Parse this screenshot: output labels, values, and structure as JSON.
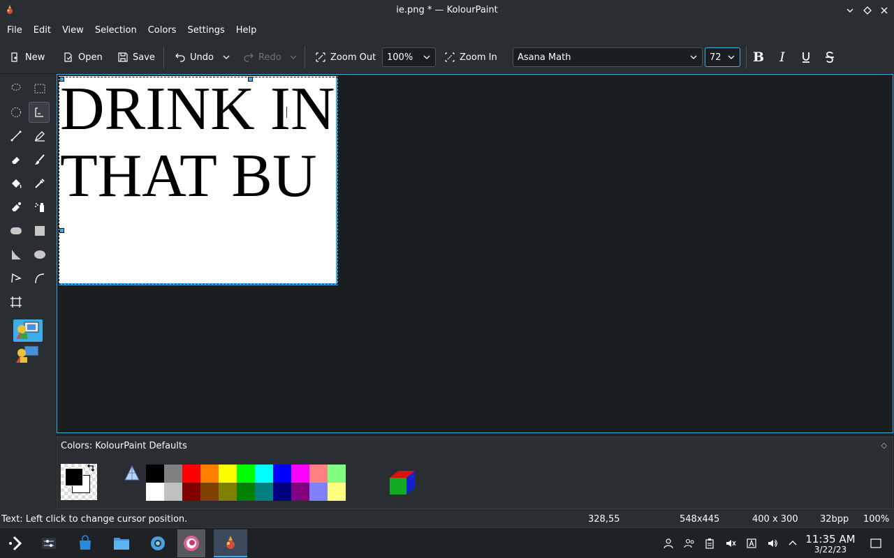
{
  "window": {
    "title": "ie.png * — KolourPaint"
  },
  "menu": [
    "File",
    "Edit",
    "View",
    "Selection",
    "Colors",
    "Settings",
    "Help"
  ],
  "toolbar": {
    "new_label": "New",
    "open_label": "Open",
    "save_label": "Save",
    "undo_label": "Undo",
    "redo_label": "Redo",
    "zoom_out_label": "Zoom Out",
    "zoom_value": "100%",
    "zoom_in_label": "Zoom In",
    "font_name": "Asana Math",
    "font_size": "72"
  },
  "document": {
    "line1": "DRINK IN",
    "line2": "THAT BU"
  },
  "colors_panel": {
    "title": "Colors: KolourPaint Defaults",
    "foreground": "#000000",
    "background": "#ffffff",
    "palette_top": [
      "#000000",
      "#808080",
      "#ff0000",
      "#ff8000",
      "#ffff00",
      "#00ff00",
      "#00ffff",
      "#0000ff",
      "#ff00ff",
      "#ff8080",
      "#80ff80"
    ],
    "palette_bottom": [
      "#ffffff",
      "#c0c0c0",
      "#800000",
      "#804000",
      "#808000",
      "#008000",
      "#008080",
      "#000080",
      "#800080",
      "#8080ff",
      "#ffff80"
    ]
  },
  "status": {
    "message": "Text: Left click to change cursor position.",
    "cursor_pos": "328,55",
    "selection_size": "548x445",
    "image_size": "400 x 300",
    "depth": "32bpp",
    "zoom": "100%"
  },
  "clock": {
    "time": "11:35 AM",
    "date": "3/22/23"
  },
  "accent": "#3daee9"
}
